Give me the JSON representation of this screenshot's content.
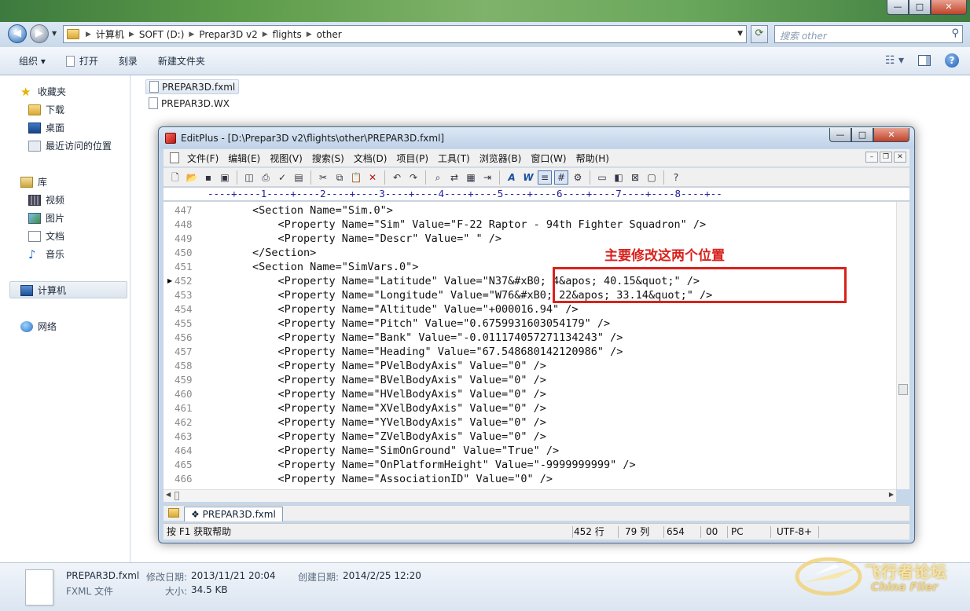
{
  "explorer": {
    "caption": {
      "min": "—",
      "max": "□",
      "close": "✕"
    },
    "breadcrumbs": [
      "计算机",
      "SOFT (D:)",
      "Prepar3D v2",
      "flights",
      "other"
    ],
    "search_placeholder": "搜索 other",
    "toolbar": {
      "organize": "组织 ▾",
      "open": "打开",
      "burn": "刻录",
      "new_folder": "新建文件夹"
    },
    "nav": {
      "favorites": "收藏夹",
      "downloads": "下载",
      "desktop": "桌面",
      "recent": "最近访问的位置",
      "libraries": "库",
      "videos": "视频",
      "pictures": "图片",
      "documents": "文档",
      "music": "音乐",
      "computer": "计算机",
      "network": "网络"
    },
    "files": [
      "PREPAR3D.fxml",
      "PREPAR3D.WX"
    ],
    "details": {
      "name": "PREPAR3D.fxml",
      "type": "FXML 文件",
      "modified_label": "修改日期:",
      "modified": "2013/11/21 20:04",
      "size_label": "大小:",
      "size": "34.5 KB",
      "created_label": "创建日期:",
      "created": "2014/2/25 12:20"
    }
  },
  "editplus": {
    "title": "EditPlus - [D:\\Prepar3D v2\\flights\\other\\PREPAR3D.fxml]",
    "menu": [
      "文件(F)",
      "编辑(E)",
      "视图(V)",
      "搜索(S)",
      "文档(D)",
      "项目(P)",
      "工具(T)",
      "浏览器(B)",
      "窗口(W)",
      "帮助(H)"
    ],
    "ruler": "----+----1----+----2----+----3----+----4----+----5----+----6----+----7----+----8----+--",
    "lines": [
      {
        "n": "447",
        "text": "        <Section Name=\"Sim.0\">"
      },
      {
        "n": "448",
        "text": "            <Property Name=\"Sim\" Value=\"F-22 Raptor - 94th Fighter Squadron\" />"
      },
      {
        "n": "449",
        "text": "            <Property Name=\"Descr\" Value=\" \" />"
      },
      {
        "n": "450",
        "text": "        </Section>"
      },
      {
        "n": "451",
        "text": "        <Section Name=\"SimVars.0\">"
      },
      {
        "n": "452",
        "text": "            <Property Name=\"Latitude\" Value=\"N37&#xB0; 4&apos; 40.15&quot;\" />"
      },
      {
        "n": "453",
        "text": "            <Property Name=\"Longitude\" Value=\"W76&#xB0; 22&apos; 33.14&quot;\" />"
      },
      {
        "n": "454",
        "text": "            <Property Name=\"Altitude\" Value=\"+000016.94\" />"
      },
      {
        "n": "455",
        "text": "            <Property Name=\"Pitch\" Value=\"0.6759931603054179\" />"
      },
      {
        "n": "456",
        "text": "            <Property Name=\"Bank\" Value=\"-0.011174057271134243\" />"
      },
      {
        "n": "457",
        "text": "            <Property Name=\"Heading\" Value=\"67.548680142120986\" />"
      },
      {
        "n": "458",
        "text": "            <Property Name=\"PVelBodyAxis\" Value=\"0\" />"
      },
      {
        "n": "459",
        "text": "            <Property Name=\"BVelBodyAxis\" Value=\"0\" />"
      },
      {
        "n": "460",
        "text": "            <Property Name=\"HVelBodyAxis\" Value=\"0\" />"
      },
      {
        "n": "461",
        "text": "            <Property Name=\"XVelBodyAxis\" Value=\"0\" />"
      },
      {
        "n": "462",
        "text": "            <Property Name=\"YVelBodyAxis\" Value=\"0\" />"
      },
      {
        "n": "463",
        "text": "            <Property Name=\"ZVelBodyAxis\" Value=\"0\" />"
      },
      {
        "n": "464",
        "text": "            <Property Name=\"SimOnGround\" Value=\"True\" />"
      },
      {
        "n": "465",
        "text": "            <Property Name=\"OnPlatformHeight\" Value=\"-9999999999\" />"
      },
      {
        "n": "466",
        "text": "            <Property Name=\"AssociationID\" Value=\"0\" />"
      }
    ],
    "current_line": "452",
    "tab": "PREPAR3D.fxml",
    "status": {
      "hint": "按 F1 获取帮助",
      "line": "452 行",
      "col": "79 列",
      "chars": "654",
      "sel": "00",
      "eol": "PC",
      "encoding": "UTF-8+"
    }
  },
  "annotation": {
    "text": "主要修改这两个位置",
    "color": "#d8221c"
  },
  "watermark": {
    "brand": "飞行者论坛",
    "sub": "China Flier"
  }
}
